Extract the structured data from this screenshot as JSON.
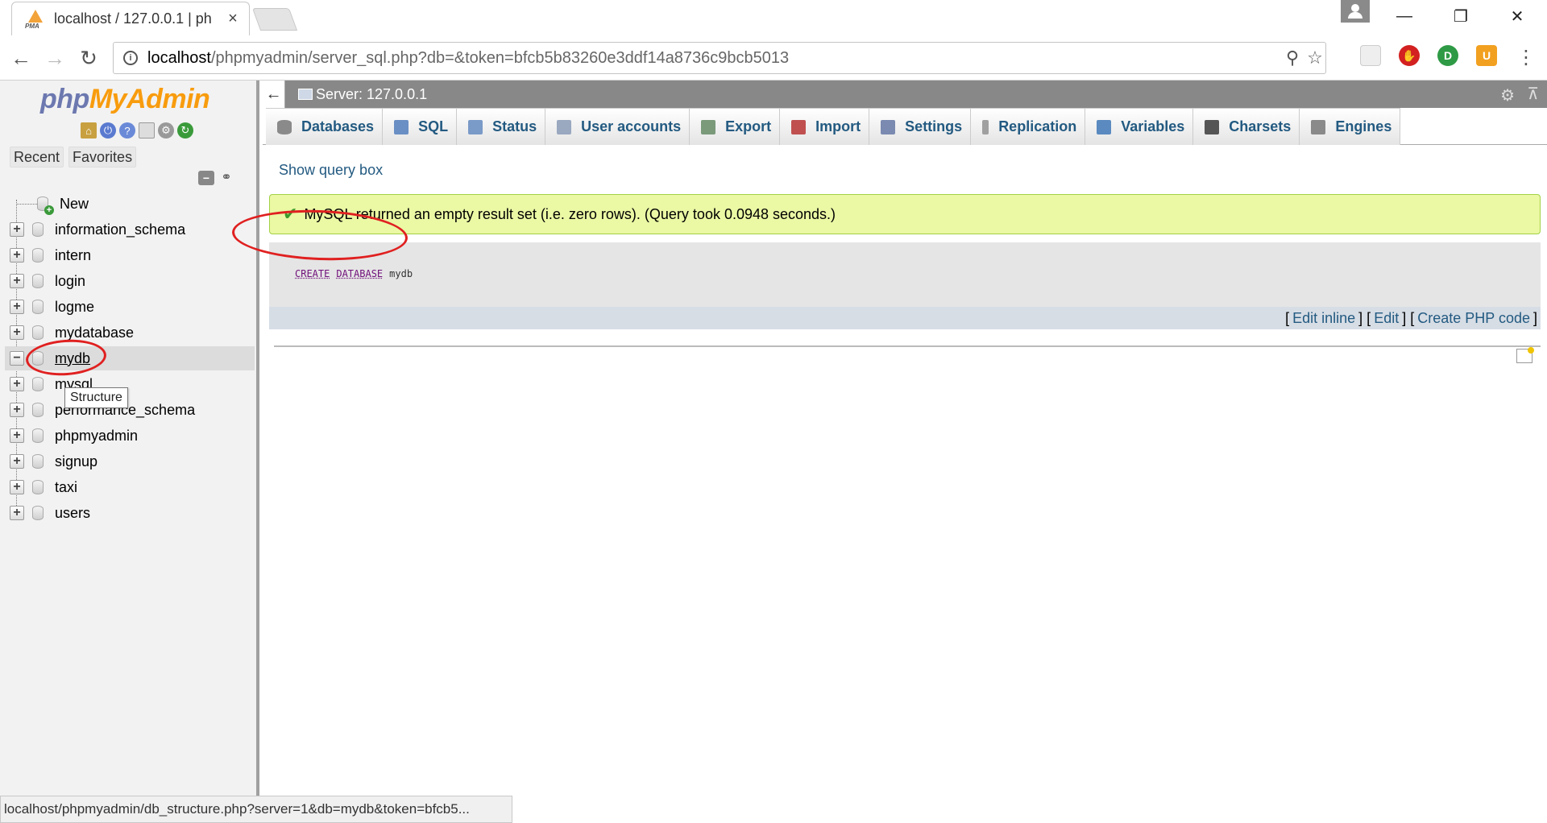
{
  "browser": {
    "tab_title": "localhost / 127.0.0.1 | ph",
    "tab_close": "×",
    "window_controls": {
      "minimize": "—",
      "maximize": "❐",
      "close": "✕"
    },
    "url_host": "localhost",
    "url_path": "/phpmyadmin/server_sql.php?db=&token=bfcb5b83260e3ddf14a8736c9bcb5013",
    "back": "←",
    "forward": "→",
    "reload": "↻",
    "zoom_icon": "⚲",
    "star_icon": "☆",
    "menu": "⋮",
    "status_url": "localhost/phpmyadmin/db_structure.php?server=1&db=mydb&token=bfcb5..."
  },
  "sidebar": {
    "logo_php": "php",
    "logo_my": "My",
    "logo_admin": "Admin",
    "tabs": [
      "Recent",
      "Favorites"
    ],
    "collapse_icon": "−",
    "link_icon": "⚭",
    "databases": [
      {
        "name": "New",
        "expander": "",
        "new": true
      },
      {
        "name": "information_schema",
        "expander": "+"
      },
      {
        "name": "intern",
        "expander": "+"
      },
      {
        "name": "login",
        "expander": "+"
      },
      {
        "name": "logme",
        "expander": "+"
      },
      {
        "name": "mydatabase",
        "expander": "+"
      },
      {
        "name": "mydb",
        "expander": "−",
        "selected": true
      },
      {
        "name": "mysql",
        "expander": "+"
      },
      {
        "name": "performance_schema",
        "expander": "+"
      },
      {
        "name": "phpmyadmin",
        "expander": "+"
      },
      {
        "name": "signup",
        "expander": "+"
      },
      {
        "name": "taxi",
        "expander": "+"
      },
      {
        "name": "users",
        "expander": "+"
      }
    ],
    "tooltip": "Structure"
  },
  "serverbar": {
    "back": "←",
    "label": "Server: 127.0.0.1",
    "gear": "⚙",
    "collapse": "⊼"
  },
  "menu": [
    {
      "label": "Databases",
      "color": "#8a8a8a"
    },
    {
      "label": "SQL",
      "color": "#6a8fc4"
    },
    {
      "label": "Status",
      "color": "#7a9ac8"
    },
    {
      "label": "User accounts",
      "color": "#9aa8c0"
    },
    {
      "label": "Export",
      "color": "#7a9a7a"
    },
    {
      "label": "Import",
      "color": "#c05050"
    },
    {
      "label": "Settings",
      "color": "#7a8ab0"
    },
    {
      "label": "Replication",
      "color": "#a0a0a0"
    },
    {
      "label": "Variables",
      "color": "#5a8ac0"
    },
    {
      "label": "Charsets",
      "color": "#555555"
    },
    {
      "label": "Engines",
      "color": "#8a8a8a"
    }
  ],
  "main": {
    "show_query_box": "Show query box",
    "success_message": "MySQL returned an empty result set (i.e. zero rows). (Query took 0.0948 seconds.)",
    "check_icon": "✔",
    "sql": {
      "kw1": "CREATE",
      "kw2": "DATABASE",
      "ident": "mydb"
    },
    "edit_links": {
      "open1": "[",
      "edit_inline": "Edit inline",
      "sep1": "] [",
      "edit": "Edit",
      "sep2": "] [",
      "create_php": "Create PHP code",
      "close": "]"
    }
  },
  "colors": {
    "link": "#235a81",
    "success_bg": "#ebf8a4",
    "serverbar_bg": "#888888",
    "annotation": "#e02020"
  }
}
